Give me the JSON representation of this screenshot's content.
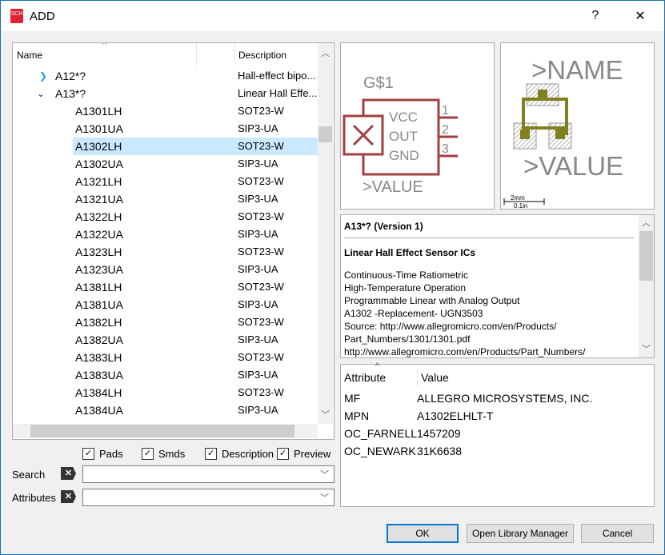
{
  "window": {
    "title": "ADD",
    "help": "?",
    "close": "✕",
    "icon_text": "SCH"
  },
  "tree": {
    "columns": {
      "name": "Name",
      "description": "Description"
    },
    "rows": [
      {
        "name": "A12*?",
        "description": "Hall-effect bipo...",
        "level": 0,
        "expander": "collapsed"
      },
      {
        "name": "A13*?",
        "description": "Linear Hall Effe...",
        "level": 0,
        "expander": "expanded"
      },
      {
        "name": "A1301LH",
        "description": "SOT23-W",
        "level": 1
      },
      {
        "name": "A1301UA",
        "description": "SIP3-UA",
        "level": 1
      },
      {
        "name": "A1302LH",
        "description": "SOT23-W",
        "level": 1,
        "selected": true
      },
      {
        "name": "A1302UA",
        "description": "SIP3-UA",
        "level": 1
      },
      {
        "name": "A1321LH",
        "description": "SOT23-W",
        "level": 1
      },
      {
        "name": "A1321UA",
        "description": "SIP3-UA",
        "level": 1
      },
      {
        "name": "A1322LH",
        "description": "SOT23-W",
        "level": 1
      },
      {
        "name": "A1322UA",
        "description": "SIP3-UA",
        "level": 1
      },
      {
        "name": "A1323LH",
        "description": "SOT23-W",
        "level": 1
      },
      {
        "name": "A1323UA",
        "description": "SIP3-UA",
        "level": 1
      },
      {
        "name": "A1381LH",
        "description": "SOT23-W",
        "level": 1
      },
      {
        "name": "A1381UA",
        "description": "SIP3-UA",
        "level": 1
      },
      {
        "name": "A1382LH",
        "description": "SOT23-W",
        "level": 1
      },
      {
        "name": "A1382UA",
        "description": "SIP3-UA",
        "level": 1
      },
      {
        "name": "A1383LH",
        "description": "SOT23-W",
        "level": 1
      },
      {
        "name": "A1383UA",
        "description": "SIP3-UA",
        "level": 1
      },
      {
        "name": "A1384LH",
        "description": "SOT23-W",
        "level": 1
      },
      {
        "name": "A1384UA",
        "description": "SIP3-UA",
        "level": 1
      }
    ]
  },
  "options": {
    "pads": "Pads",
    "smds": "Smds",
    "description": "Description",
    "preview": "Preview"
  },
  "search": {
    "label": "Search",
    "value": ""
  },
  "attributes_filter": {
    "label": "Attributes",
    "value": ""
  },
  "schematic": {
    "name": "G$1",
    "value": ">VALUE",
    "pins": [
      "VCC",
      "OUT",
      "GND"
    ],
    "pin_numbers": [
      "1",
      "2",
      "3"
    ],
    "color": "#a04040"
  },
  "package": {
    "name": ">NAME",
    "value": ">VALUE",
    "scale_mm": "2mm",
    "scale_in": "0.1in",
    "trace_color": "#808020"
  },
  "description": {
    "title": "A13*? (Version 1)",
    "heading": "Linear Hall Effect Sensor ICs",
    "lines": [
      "Continuous-Time Ratiometric",
      "High-Temperature Operation",
      "Programmable Linear with Analog Output",
      "A1302 -Replacement- UGN3503",
      "Source: http://www.allegromicro.com/en/Products/",
      "Part_Numbers/1301/1301.pdf",
      "http://www.allegromicro.com/en/Products/Part_Numbers/"
    ]
  },
  "attributes": {
    "columns": {
      "attribute": "Attribute",
      "value": "Value"
    },
    "rows": [
      {
        "attribute": "MF",
        "value": "ALLEGRO MICROSYSTEMS, INC."
      },
      {
        "attribute": "MPN",
        "value": "A1302ELHLT-T"
      },
      {
        "attribute": "OC_FARNELL",
        "value": "1457209"
      },
      {
        "attribute": "OC_NEWARK",
        "value": "31K6638"
      }
    ]
  },
  "buttons": {
    "ok": "OK",
    "library_manager": "Open Library Manager",
    "cancel": "Cancel"
  }
}
